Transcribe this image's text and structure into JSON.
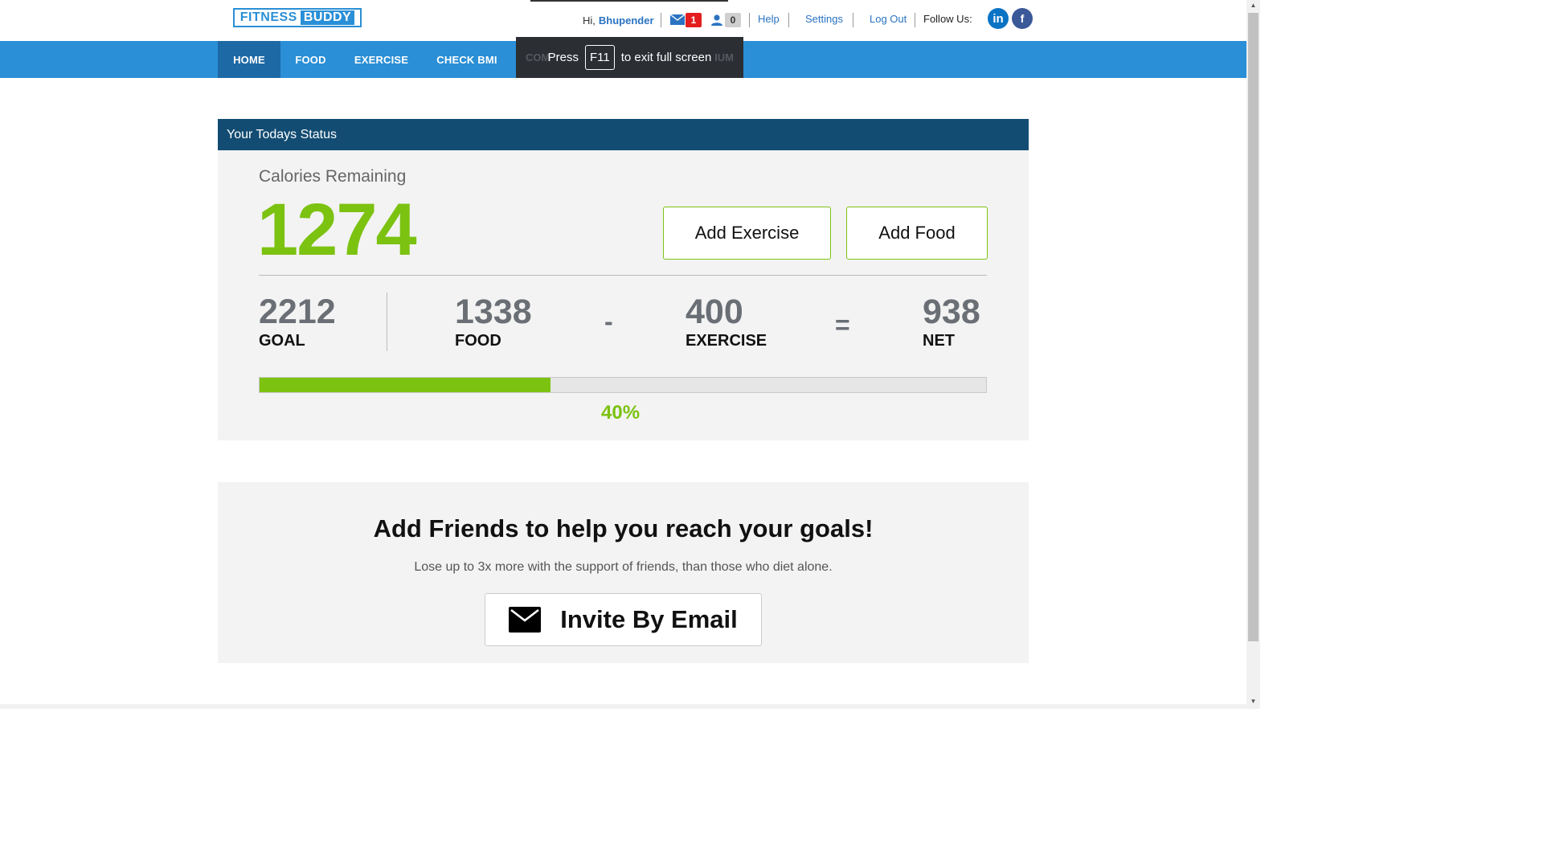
{
  "header": {
    "logo_left": "FITNESS",
    "logo_right": "BUDDY",
    "greeting": "Hi,",
    "username": "Bhupender",
    "messages_count": "1",
    "friend_requests_count": "0",
    "help": "Help",
    "settings": "Settings",
    "logout": "Log Out",
    "follow_us": "Follow Us:",
    "linkedin_icon_text": "in",
    "facebook_icon_text": "f"
  },
  "nav": {
    "items": [
      "HOME",
      "FOOD",
      "EXERCISE",
      "CHECK BMI"
    ],
    "hidden_left": "COM",
    "hidden_right": "IUM"
  },
  "fullscreen_notice": {
    "press": "Press",
    "key": "F11",
    "message": "to exit full screen"
  },
  "status": {
    "title": "Your Todays Status",
    "calories_label": "Calories Remaining",
    "calories_value": "1274",
    "add_exercise": "Add Exercise",
    "add_food": "Add Food",
    "goal_value": "2212",
    "goal_label": "GOAL",
    "food_value": "1338",
    "food_label": "FOOD",
    "minus": "-",
    "exercise_value": "400",
    "exercise_label": "EXERCISE",
    "equals": "=",
    "net_value": "938",
    "net_label": "NET",
    "progress_fraction": 0.4,
    "progress_label": "40%"
  },
  "friends": {
    "title": "Add Friends to help you reach your goals!",
    "subtitle": "Lose up to 3x more with the support of friends, than those who diet alone.",
    "invite_button": "Invite By Email"
  },
  "colors": {
    "brand_blue": "#2a8fd6",
    "header_dark": "#134c72",
    "accent_green": "#7cc211"
  }
}
